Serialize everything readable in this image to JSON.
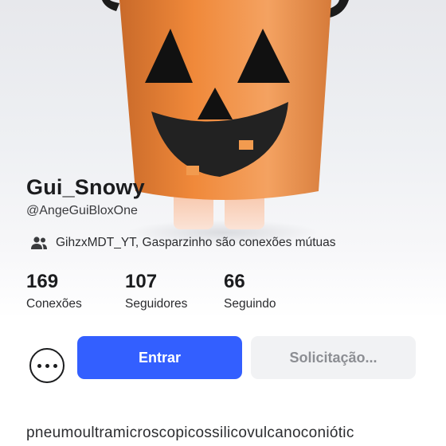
{
  "profile": {
    "display_name": "Gui_Snowy",
    "username": "@AngeGuiBloxOne",
    "mutual_connections_text": "GihzxMDT_YT, Gasparzinho são conexões mútuas"
  },
  "stats": [
    {
      "value": "169",
      "label": "Conexões"
    },
    {
      "value": "107",
      "label": "Seguidores"
    },
    {
      "value": "66",
      "label": "Seguindo"
    }
  ],
  "actions": {
    "more_icon": "ellipsis-icon",
    "join_label": "Entrar",
    "request_label": "Solicitação..."
  },
  "about": {
    "text": "pneumoultramicroscopicossilicovulcanoconiótic"
  },
  "colors": {
    "primary_button": "#335fff",
    "secondary_button": "#f1f2f4",
    "avatar_orange": "#f0893a"
  }
}
